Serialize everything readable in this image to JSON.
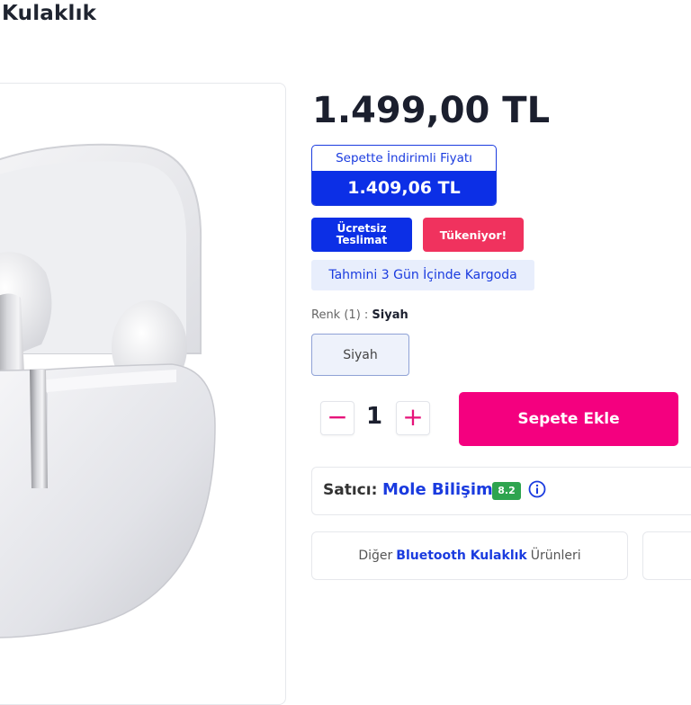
{
  "product": {
    "title": "Kulaklık",
    "price": "1.499,00 TL"
  },
  "discount": {
    "label": "Sepette İndirimli Fiyatı",
    "value": "1.409,06 TL"
  },
  "badges": {
    "free_shipping_line1": "Ücretsiz",
    "free_shipping_line2": "Teslimat",
    "low_stock": "Tükeniyor!"
  },
  "cargo": "Tahmini 3 Gün İçinde Kargoda",
  "color": {
    "label": "Renk (1) : ",
    "selected": "Siyah",
    "options": [
      "Siyah"
    ]
  },
  "quantity": {
    "minus": "−",
    "value": "1",
    "plus": "+"
  },
  "add_to_cart": "Sepete Ekle",
  "seller": {
    "label": "Satıcı:",
    "name": "Mole Bilişim",
    "score": "8.2",
    "info_icon": "info-icon"
  },
  "other_products": {
    "prefix": "Diğer",
    "category": "Bluetooth Kulaklık",
    "suffix": "Ürünleri"
  },
  "colors": {
    "primary_blue": "#0c2fe6",
    "pink": "#f4007f",
    "red": "#f0325e",
    "green": "#2ea44f"
  }
}
